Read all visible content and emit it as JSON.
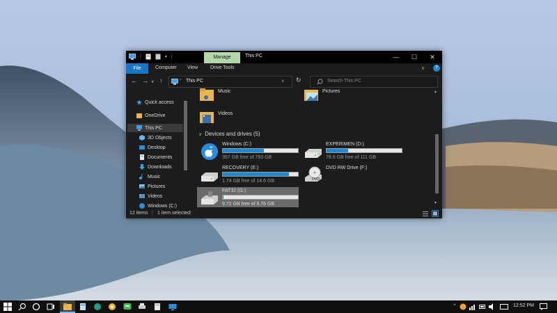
{
  "window": {
    "title": "This PC",
    "manage_tab": "Manage",
    "controls": {
      "minimize": "—",
      "maximize": "☐",
      "close": "✕"
    }
  },
  "ribbon": {
    "tabs": [
      "File",
      "Computer",
      "View",
      "Drive Tools"
    ]
  },
  "address": {
    "path": "This PC",
    "search_placeholder": "Search This PC"
  },
  "sidebar": {
    "items": [
      {
        "label": "Quick access",
        "icon": "star-icon"
      },
      {
        "label": "OneDrive",
        "icon": "onedrive-folder-icon"
      },
      {
        "label": "This PC",
        "icon": "computer-icon"
      },
      {
        "label": "3D Objects",
        "icon": "3d-objects-icon"
      },
      {
        "label": "Desktop",
        "icon": "desktop-icon"
      },
      {
        "label": "Documents",
        "icon": "documents-icon"
      },
      {
        "label": "Downloads",
        "icon": "downloads-icon"
      },
      {
        "label": "Music",
        "icon": "music-icon"
      },
      {
        "label": "Pictures",
        "icon": "pictures-icon"
      },
      {
        "label": "Videos",
        "icon": "videos-icon"
      },
      {
        "label": "Windows (C:)",
        "icon": "drive-icon"
      }
    ]
  },
  "folders": [
    {
      "label": "Music"
    },
    {
      "label": "Pictures"
    },
    {
      "label": "Videos"
    }
  ],
  "devices": {
    "header": "Devices and drives (5)",
    "drives": [
      {
        "name": "Windows (C:)",
        "free": "357 GB free of 793 GB",
        "used_fraction": 0.55
      },
      {
        "name": "EXPERIMEN (D:)",
        "free": "78.6 GB free of 111 GB",
        "used_fraction": 0.29
      },
      {
        "name": "RECOVERY (E:)",
        "free": "1.74 GB free of 14.6 GB",
        "used_fraction": 0.88
      },
      {
        "name": "DVD RW Drive (F:)",
        "free": ""
      },
      {
        "name": "FAT32 (G:)",
        "free": "9.72 GB free of 9.76 GB",
        "used_fraction": 0.004
      }
    ]
  },
  "status": {
    "items_count": "12 items",
    "selected": "1 item selected"
  },
  "taskbar": {
    "clock": "12:52 PM"
  }
}
